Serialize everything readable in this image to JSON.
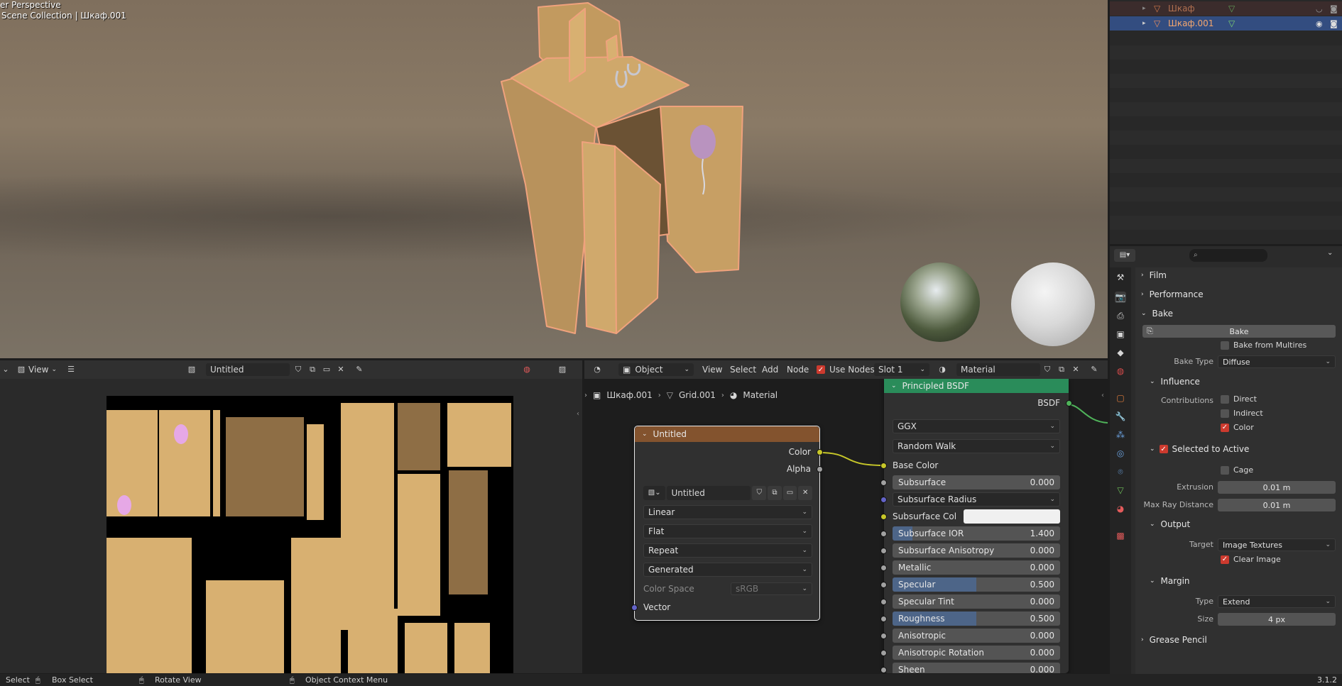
{
  "viewport": {
    "mode_label": "er Perspective",
    "collection_label": "Scene Collection | Шкаф.001"
  },
  "outliner": {
    "items": [
      {
        "name": "Шкаф",
        "state": "dimmed"
      },
      {
        "name": "Шкаф.001",
        "state": "selected"
      }
    ]
  },
  "properties": {
    "panels": {
      "film": "Film",
      "performance": "Performance",
      "bake": "Bake"
    },
    "bake_button": "Bake",
    "bake_from_multires": "Bake from Multires",
    "bake_type_label": "Bake Type",
    "bake_type_value": "Diffuse",
    "influence": {
      "header": "Influence",
      "contributions_label": "Contributions",
      "direct": "Direct",
      "indirect": "Indirect",
      "color": "Color"
    },
    "selected_to_active": {
      "header": "Selected to Active",
      "cage": "Cage",
      "extrusion_label": "Extrusion",
      "extrusion_value": "0.01 m",
      "max_ray_label": "Max Ray Distance",
      "max_ray_value": "0.01 m"
    },
    "output": {
      "header": "Output",
      "target_label": "Target",
      "target_value": "Image Textures",
      "clear_image": "Clear Image"
    },
    "margin": {
      "header": "Margin",
      "type_label": "Type",
      "type_value": "Extend",
      "size_label": "Size",
      "size_value": "4 px"
    },
    "grease_pencil": "Grease Pencil"
  },
  "image_editor": {
    "view_menu": "View",
    "image_name": "Untitled"
  },
  "node_editor": {
    "object_mode": "Object",
    "menus": [
      "View",
      "Select",
      "Add",
      "Node"
    ],
    "use_nodes": "Use Nodes",
    "slot": "Slot 1",
    "material": "Material",
    "breadcrumb": [
      "Шкаф.001",
      "Grid.001",
      "Material"
    ],
    "image_node": {
      "title": "Untitled",
      "out_color": "Color",
      "out_alpha": "Alpha",
      "image_name": "Untitled",
      "interpolation": "Linear",
      "projection": "Flat",
      "extension": "Repeat",
      "source": "Generated",
      "color_space_label": "Color Space",
      "color_space_value": "sRGB",
      "in_vector": "Vector"
    },
    "bsdf_node": {
      "title": "Principled BSDF",
      "out_bsdf": "BSDF",
      "distribution": "GGX",
      "subsurface_method": "Random Walk",
      "base_color": "Base Color",
      "subsurface_col": "Subsurface Col",
      "subsurface_radius": "Subsurface Radius",
      "sliders": [
        {
          "label": "Subsurface",
          "value": "0.000",
          "fill": 0
        },
        {
          "label": "Subsurface IOR",
          "value": "1.400",
          "fill": 0.12
        },
        {
          "label": "Subsurface Anisotropy",
          "value": "0.000",
          "fill": 0
        },
        {
          "label": "Metallic",
          "value": "0.000",
          "fill": 0
        },
        {
          "label": "Specular",
          "value": "0.500",
          "fill": 0.5
        },
        {
          "label": "Specular Tint",
          "value": "0.000",
          "fill": 0
        },
        {
          "label": "Roughness",
          "value": "0.500",
          "fill": 0.5
        },
        {
          "label": "Anisotropic",
          "value": "0.000",
          "fill": 0
        },
        {
          "label": "Anisotropic Rotation",
          "value": "0.000",
          "fill": 0
        },
        {
          "label": "Sheen",
          "value": "0.000",
          "fill": 0
        }
      ]
    }
  },
  "statusbar": {
    "select": "Select",
    "box_select": "Box Select",
    "rotate_view": "Rotate View",
    "context_menu": "Object Context Menu",
    "version": "3.1.2"
  },
  "colors": {
    "accent": "#4772b3",
    "checkbox_on": "#cc3a2e",
    "node_image_header": "#83532e",
    "node_shader_header": "#2a8c5a",
    "socket_color": "#c7c729",
    "socket_float": "#a1a1a1",
    "socket_vector": "#6363c7",
    "selection_outline": "#f0a27d",
    "wood": "#d8b071"
  }
}
